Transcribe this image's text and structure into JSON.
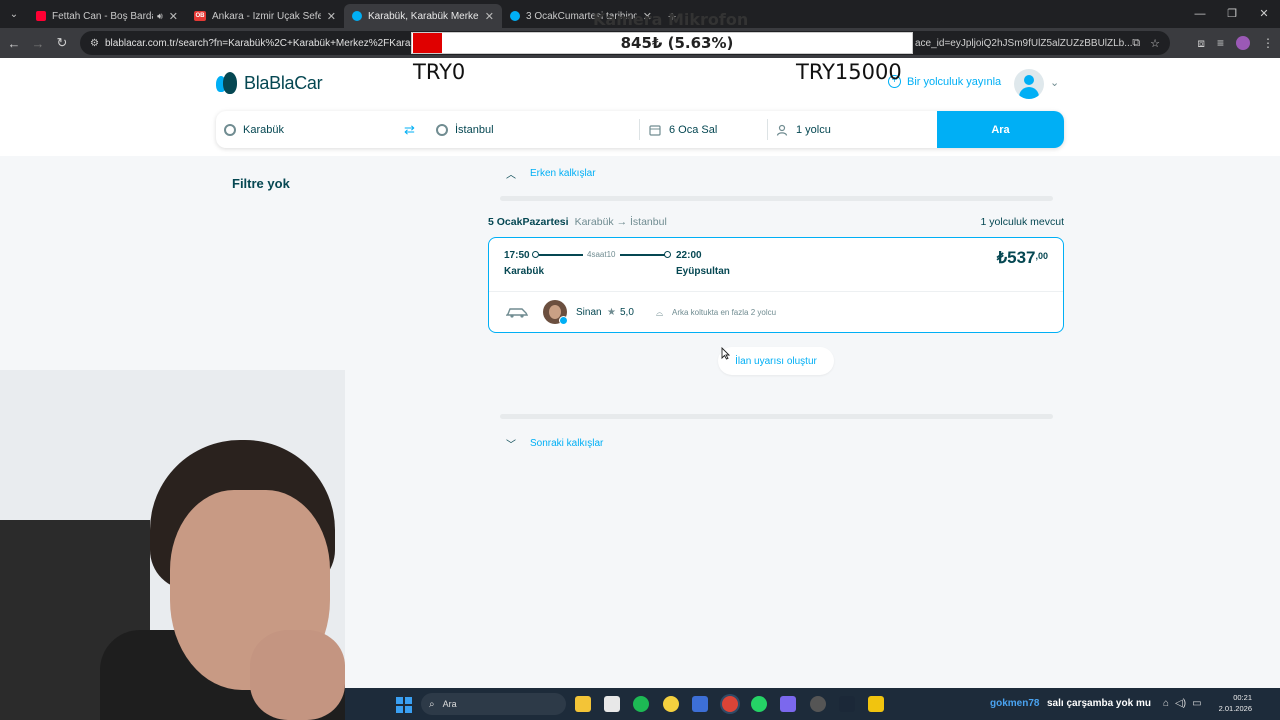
{
  "browser": {
    "tabs": [
      {
        "title": "Fettah Can - Boş Bardak - Y",
        "fav_color": "#ff0033",
        "active": false,
        "audio": true
      },
      {
        "title": "Ankara - İzmir Uçak Seferi - ob",
        "fav_color": "#e53935",
        "fav_text": "OB",
        "active": false
      },
      {
        "title": "Karabük, Karabük Merkez/Karab",
        "fav_color": "#00aff5",
        "active": true
      },
      {
        "title": "3 OcakCumartesi tarihinde Kar",
        "fav_color": "#00aff5",
        "active": false
      }
    ],
    "url_start": "blablacar.com.tr/search?fn=Karabük%2C+Karabük+Merkez%2FKarabük%2",
    "url_end": "ace_id=eyJpljoiQ2hJSm9fUlZ5alZUZzBBUlZLb..."
  },
  "overlay": {
    "camera_label": "Kamera Mikrofon",
    "progress_text": "845₺ (5.63%)",
    "progress_fraction": 0.0563,
    "min_label": "TRY0",
    "max_label": "TRY15000"
  },
  "header": {
    "logo_text": "BlaBlaCar",
    "publish_label": "Bir yolculuk yayınla"
  },
  "search": {
    "from": "Karabük",
    "to": "İstanbul",
    "date": "6 Oca Sal",
    "passengers": "1 yolcu",
    "button": "Ara"
  },
  "filters": {
    "title": "Filtre yok"
  },
  "results": {
    "earlier_label": "Erken kalkışlar",
    "date_label": "5 OcakPazartesi",
    "route_label": "Karabük → İstanbul",
    "count_label": "1 yolculuk mevcut",
    "later_label": "Sonraki kalkışlar",
    "alert_button": "İlan uyarısı oluştur",
    "trips": [
      {
        "departure_time": "17:50",
        "departure_city": "Karabük",
        "duration": "4saat10",
        "arrival_time": "22:00",
        "arrival_city": "Eyüpsultan",
        "price_currency": "₺",
        "price_int": "537",
        "price_dec": ",00",
        "driver_name": "Sinan",
        "rating": "5,0",
        "perk": "Arka koltukta en fazla 2 yolcu"
      }
    ]
  },
  "taskbar": {
    "search_label": "Ara",
    "username": "gokmen78",
    "message": "salı çarşamba yok mu",
    "time": "00:21",
    "date": "2.01.2026"
  }
}
